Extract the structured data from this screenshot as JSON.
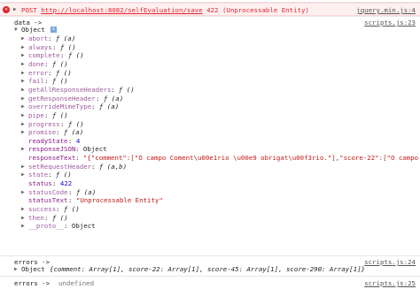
{
  "error": {
    "method": "POST",
    "url": "http://localhost:8082/selfEvaluation/save",
    "status": "422 (Unprocessable Entity)",
    "source": "jquery.min.js:4"
  },
  "log1": {
    "label": "data ->",
    "source": "scripts.js:23",
    "object_label": "Object",
    "info_badge": "i",
    "props": [
      {
        "key": "abort",
        "value": "ƒ (a)",
        "expandable": true,
        "own": false,
        "type": "fn"
      },
      {
        "key": "always",
        "value": "ƒ ()",
        "expandable": true,
        "own": false,
        "type": "fn"
      },
      {
        "key": "complete",
        "value": "ƒ ()",
        "expandable": true,
        "own": false,
        "type": "fn"
      },
      {
        "key": "done",
        "value": "ƒ ()",
        "expandable": true,
        "own": false,
        "type": "fn"
      },
      {
        "key": "error",
        "value": "ƒ ()",
        "expandable": true,
        "own": false,
        "type": "fn"
      },
      {
        "key": "fail",
        "value": "ƒ ()",
        "expandable": true,
        "own": false,
        "type": "fn"
      },
      {
        "key": "getAllResponseHeaders",
        "value": "ƒ ()",
        "expandable": true,
        "own": false,
        "type": "fn"
      },
      {
        "key": "getResponseHeader",
        "value": "ƒ (a)",
        "expandable": true,
        "own": false,
        "type": "fn"
      },
      {
        "key": "overrideMimeType",
        "value": "ƒ (a)",
        "expandable": true,
        "own": false,
        "type": "fn"
      },
      {
        "key": "pipe",
        "value": "ƒ ()",
        "expandable": true,
        "own": false,
        "type": "fn"
      },
      {
        "key": "progress",
        "value": "ƒ ()",
        "expandable": true,
        "own": false,
        "type": "fn"
      },
      {
        "key": "promise",
        "value": "ƒ (a)",
        "expandable": true,
        "own": false,
        "type": "fn"
      },
      {
        "key": "readyState",
        "value": "4",
        "expandable": false,
        "own": true,
        "type": "num"
      },
      {
        "key": "responseJSON",
        "value": "Object",
        "expandable": true,
        "own": true,
        "type": "obj"
      },
      {
        "key": "responseText",
        "value": "\"{\"comment\":[\"O campo Coment\\u00e1rio \\u00e9 obrigat\\u00f3rio.\"],\"score-22\":[\"O campo",
        "expandable": false,
        "own": true,
        "type": "str"
      },
      {
        "key": "setRequestHeader",
        "value": "ƒ (a,b)",
        "expandable": true,
        "own": false,
        "type": "fn"
      },
      {
        "key": "state",
        "value": "ƒ ()",
        "expandable": true,
        "own": false,
        "type": "fn"
      },
      {
        "key": "status",
        "value": "422",
        "expandable": false,
        "own": true,
        "type": "num"
      },
      {
        "key": "statusCode",
        "value": "ƒ (a)",
        "expandable": true,
        "own": false,
        "type": "fn"
      },
      {
        "key": "statusText",
        "value": "\"Unprocessable Entity\"",
        "expandable": false,
        "own": true,
        "type": "str"
      },
      {
        "key": "success",
        "value": "ƒ ()",
        "expandable": true,
        "own": false,
        "type": "fn"
      },
      {
        "key": "then",
        "value": "ƒ ()",
        "expandable": true,
        "own": false,
        "type": "fn"
      },
      {
        "key": "__proto__",
        "value": "Object",
        "expandable": true,
        "own": false,
        "type": "obj"
      }
    ]
  },
  "log2": {
    "label": "errors ->",
    "source": "scripts.js:24",
    "object_label": "Object",
    "preview": "{comment: Array[1], score-22: Array[1], score-45: Array[1], score-290: Array[1]}"
  },
  "log3": {
    "label": "errors ->",
    "value": "undefined",
    "source": "scripts.js:25"
  }
}
